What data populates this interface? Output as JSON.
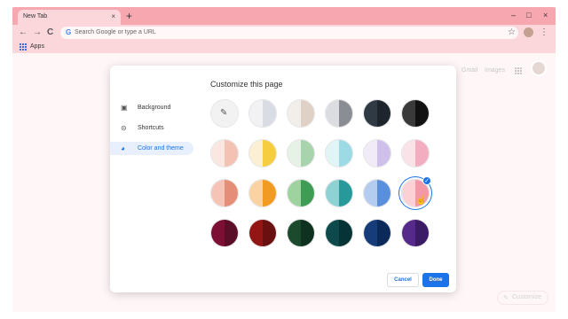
{
  "browser": {
    "tab_title": "New Tab",
    "tab_close": "×",
    "new_tab": "+",
    "minimize": "–",
    "maximize": "□",
    "close": "×",
    "back": "←",
    "forward": "→",
    "reload": "C",
    "omnibox_icon": "G",
    "omnibox_placeholder": "Search Google or type a URL",
    "star": "☆",
    "menu": "⋮",
    "bookmarks": {
      "apps_label": "Apps"
    },
    "theme_color": "#f6a7b0"
  },
  "ntp": {
    "links": [
      "Gmail",
      "Images"
    ],
    "customize_label": "Customize",
    "customize_icon": "✎"
  },
  "dialog": {
    "title": "Customize this page",
    "sidebar": [
      {
        "label": "Background",
        "icon": "▣",
        "icon_name": "image-icon"
      },
      {
        "label": "Shortcuts",
        "icon": "⊝",
        "icon_name": "link-icon"
      },
      {
        "label": "Color and theme",
        "icon": "◕",
        "icon_name": "palette-icon",
        "active": true
      }
    ],
    "swatch_rows": [
      [
        {
          "l": "#f2f2f2",
          "r": "#f2f2f2",
          "custom": true
        },
        {
          "l": "#f2f2f4",
          "r": "#d9dce2"
        },
        {
          "l": "#f2eeea",
          "r": "#dfd1c6"
        },
        {
          "l": "#dcdde0",
          "r": "#8a8d93"
        },
        {
          "l": "#303a44",
          "r": "#1e252c"
        },
        {
          "l": "#3a3a3a",
          "r": "#111111"
        }
      ],
      [
        {
          "l": "#fbe7e1",
          "r": "#f3c2b3"
        },
        {
          "l": "#fbf0d3",
          "r": "#f6cd3e"
        },
        {
          "l": "#e6f2e6",
          "r": "#a8d4ad"
        },
        {
          "l": "#e1f4f6",
          "r": "#9cdbe6"
        },
        {
          "l": "#f1ebf7",
          "r": "#cfc0eb"
        },
        {
          "l": "#f9e3e8",
          "r": "#f2aec0"
        }
      ],
      [
        {
          "l": "#f6c4b7",
          "r": "#e48e78"
        },
        {
          "l": "#fbd3a3",
          "r": "#f29b22"
        },
        {
          "l": "#9ed39f",
          "r": "#3e9c55"
        },
        {
          "l": "#8fd2d4",
          "r": "#27999b"
        },
        {
          "l": "#b4ccf0",
          "r": "#5a8fdc"
        },
        {
          "l": "#fbd1d6",
          "r": "#f398a6",
          "selected": true
        }
      ],
      [
        {
          "l": "#7d0f35",
          "r": "#5a0e27"
        },
        {
          "l": "#931615",
          "r": "#6b1010"
        },
        {
          "l": "#1c4a2d",
          "r": "#0f3120"
        },
        {
          "l": "#0e4a4b",
          "r": "#063335"
        },
        {
          "l": "#163c7a",
          "r": "#0b2a5a"
        },
        {
          "l": "#552a8a",
          "r": "#3b1a66"
        }
      ]
    ],
    "pencil_icon": "✎",
    "check_mark": "✓",
    "cursor": "☝",
    "cancel_label": "Cancel",
    "done_label": "Done",
    "accent": "#1a73e8"
  }
}
